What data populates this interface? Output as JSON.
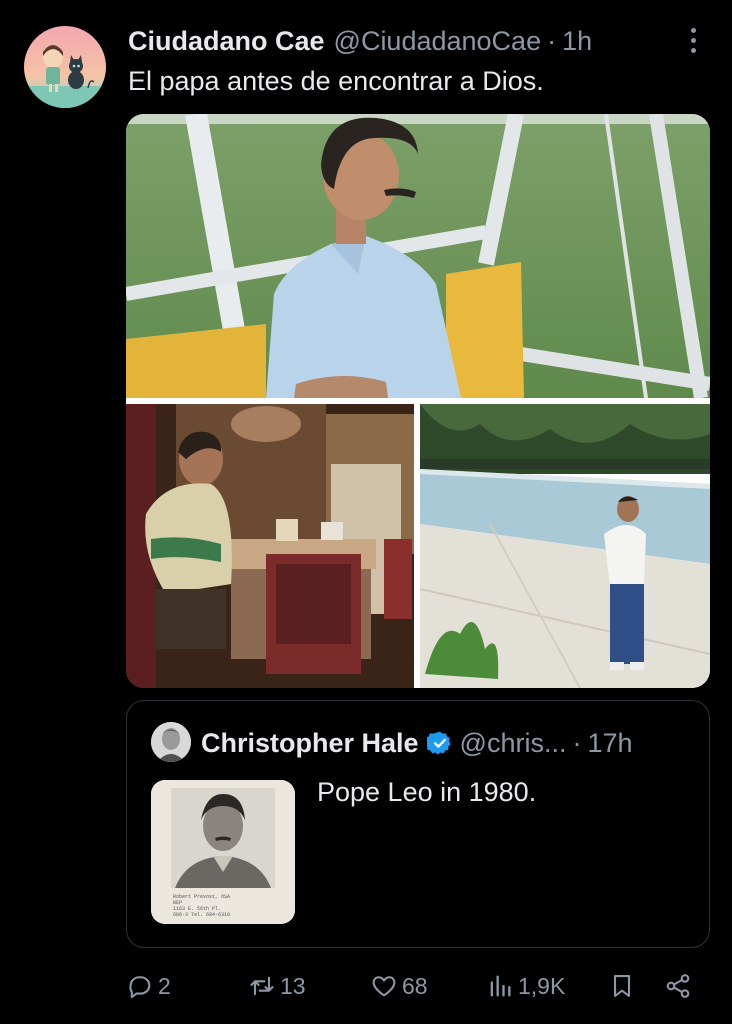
{
  "tweet": {
    "author_name": "Ciudadano Cae",
    "author_handle": "@CiudadanoCae",
    "separator": "·",
    "time": "1h",
    "text": "El papa antes de encontrar a Dios.",
    "avatar_icon": "cartoon-girl-and-cat-avatar"
  },
  "quote": {
    "author_name": "Christopher Hale",
    "author_handle": "@chris...",
    "separator": "·",
    "time": "17h",
    "text": "Pope Leo in 1980.",
    "verified": true,
    "thumb_caption": [
      "Robert Prevost, OSA",
      "BEP",
      "1163 E. 56th Pl.",
      "606-3 Tel. 684-6310"
    ]
  },
  "actions": {
    "replies": "2",
    "reposts": "13",
    "likes": "68",
    "views": "1,9K"
  },
  "colors": {
    "background": "#000000",
    "text_primary": "#e7e9ea",
    "text_secondary": "#8b98a5",
    "border": "#2f3336",
    "verified_blue": "#1d9bf0"
  }
}
